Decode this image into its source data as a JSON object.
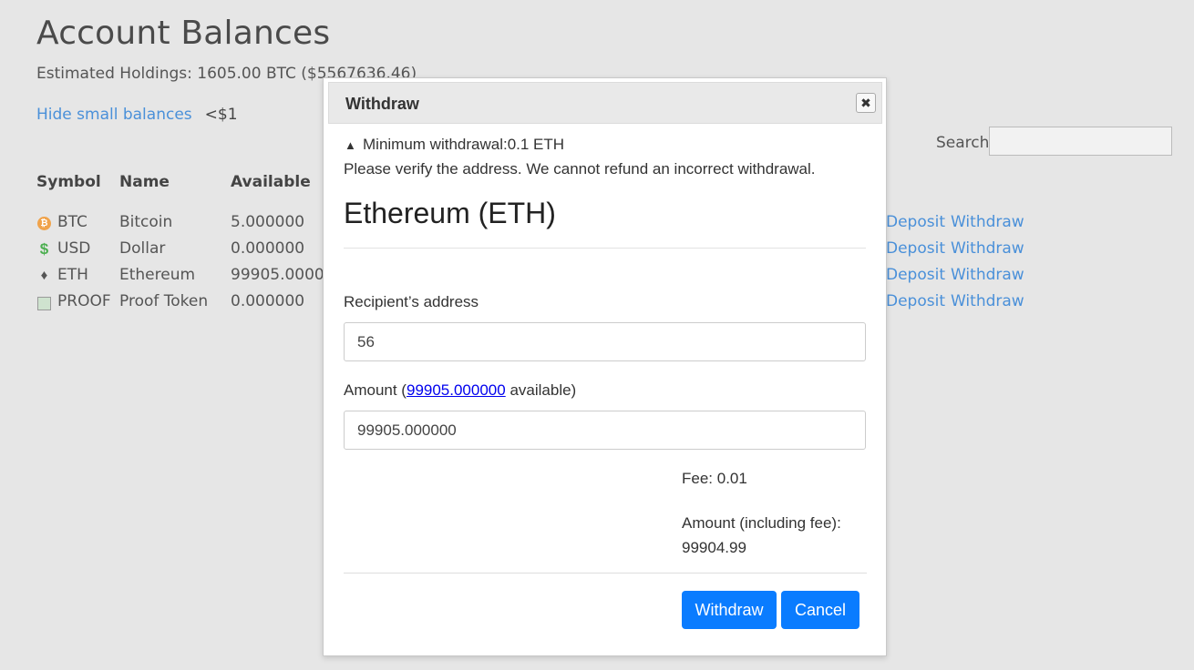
{
  "page": {
    "title": "Account Balances",
    "holdings": "Estimated Holdings: 1605.00 BTC ($5567636.46)",
    "hide_small_link": "Hide small balances",
    "threshold": "<$1",
    "search_label": "Search",
    "search_value": ""
  },
  "table": {
    "headers": [
      "Symbol",
      "Name",
      "Available"
    ],
    "rows": [
      {
        "icon": "bitcoin-icon",
        "symbol": "BTC",
        "name": "Bitcoin",
        "available": "5.000000"
      },
      {
        "icon": "dollar-icon",
        "symbol": "USD",
        "name": "Dollar",
        "available": "0.000000"
      },
      {
        "icon": "ethereum-icon",
        "symbol": "ETH",
        "name": "Ethereum",
        "available": "99905.00000"
      },
      {
        "icon": "broken-image-icon",
        "symbol": "PROOF",
        "name": "Proof Token",
        "available": "0.000000"
      }
    ],
    "deposit_label": "Deposit",
    "withdraw_label": "Withdraw"
  },
  "modal": {
    "title": "Withdraw",
    "close_glyph": "✖",
    "minimum": "Minimum withdrawal:0.1 ETH",
    "verify": "Please verify the address. We cannot refund an incorrect withdrawal.",
    "coin": "Ethereum (ETH)",
    "recipient_label": "Recipient’s address",
    "recipient_value": "56",
    "amount_label_prefix": "Amount (",
    "amount_available_link": "99905.000000",
    "amount_label_suffix": " available)",
    "amount_value": "99905.000000",
    "fee": "Fee: 0.01",
    "total_label": "Amount (including fee):",
    "total_value": "99904.99",
    "withdraw_button": "Withdraw",
    "cancel_button": "Cancel"
  }
}
